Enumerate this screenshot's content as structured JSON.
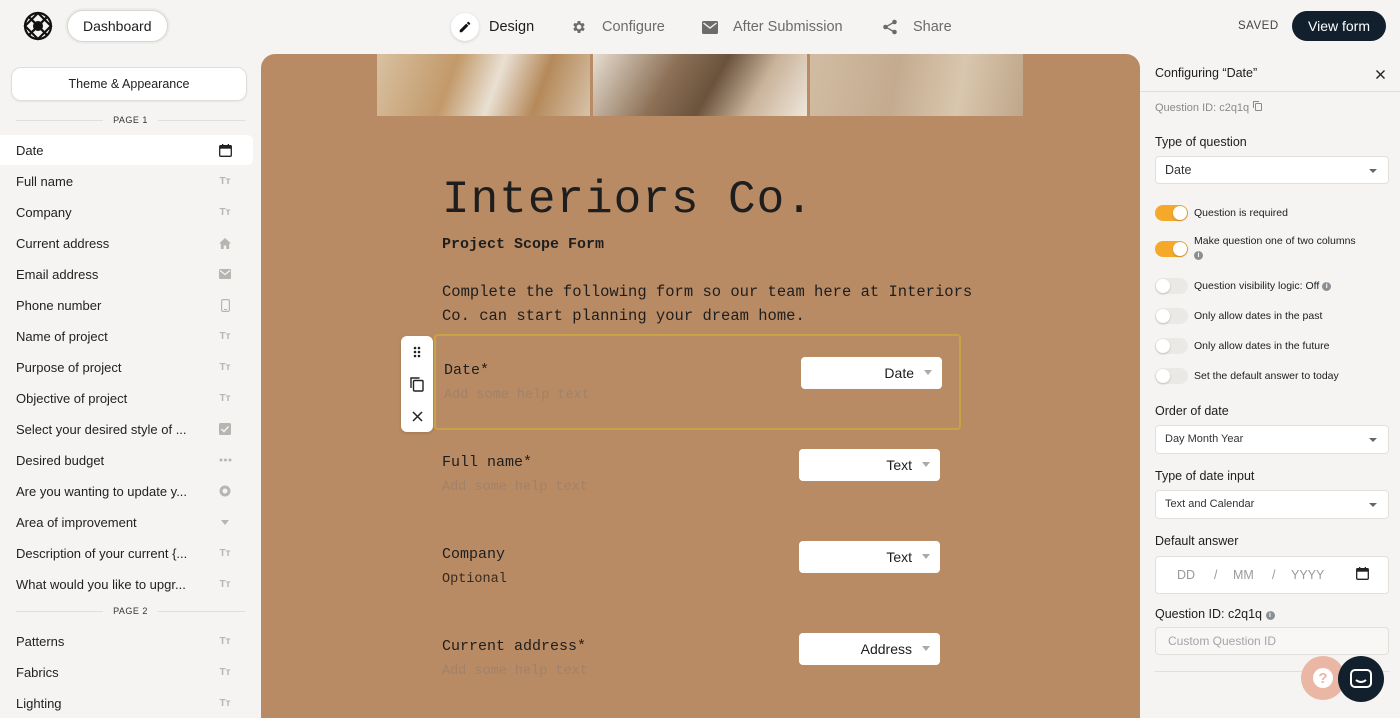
{
  "topbar": {
    "dashboard_label": "Dashboard",
    "tabs": [
      {
        "label": "Design",
        "icon": "pencil-icon"
      },
      {
        "label": "Configure",
        "icon": "gear-icon"
      },
      {
        "label": "After Submission",
        "icon": "envelope-icon"
      },
      {
        "label": "Share",
        "icon": "share-icon"
      }
    ],
    "status": "SAVED",
    "view_form_label": "View form"
  },
  "sidebar": {
    "theme_label": "Theme & Appearance",
    "page1_label": "PAGE 1",
    "page2_label": "PAGE 2",
    "page1_items": [
      {
        "label": "Date",
        "icon": "calendar-icon"
      },
      {
        "label": "Full name",
        "icon": "text-icon"
      },
      {
        "label": "Company",
        "icon": "text-icon"
      },
      {
        "label": "Current address",
        "icon": "home-icon"
      },
      {
        "label": "Email address",
        "icon": "email-icon"
      },
      {
        "label": "Phone number",
        "icon": "phone-icon"
      },
      {
        "label": "Name of project",
        "icon": "text-icon"
      },
      {
        "label": "Purpose of project",
        "icon": "text-icon"
      },
      {
        "label": "Objective of project",
        "icon": "text-icon"
      },
      {
        "label": "Select your desired style of ...",
        "icon": "checkbox-icon"
      },
      {
        "label": "Desired budget",
        "icon": "dots-icon"
      },
      {
        "label": "Are you wanting to update y...",
        "icon": "radio-icon"
      },
      {
        "label": "Area of improvement",
        "icon": "dropdown-icon"
      },
      {
        "label": "Description of your current {...",
        "icon": "text-icon"
      },
      {
        "label": "What would you like to upgr...",
        "icon": "text-icon"
      }
    ],
    "page2_items": [
      {
        "label": "Patterns",
        "icon": "text-icon"
      },
      {
        "label": "Fabrics",
        "icon": "text-icon"
      },
      {
        "label": "Lighting",
        "icon": "text-icon"
      }
    ],
    "text_icon_glyph": "Tт"
  },
  "form": {
    "title": "Interiors Co.",
    "subtitle": "Project Scope Form",
    "description": "Complete the following form so our team here at Interiors Co. can start planning your dream home.",
    "questions": [
      {
        "label": "Date*",
        "help": "Add some help text",
        "type": "Date"
      },
      {
        "label": "Full name*",
        "help": "Add some help text",
        "type": "Text"
      },
      {
        "label": "Company",
        "help": "Optional",
        "type": "Text"
      },
      {
        "label": "Current address*",
        "help": "Add some help text",
        "type": "Address"
      }
    ]
  },
  "config": {
    "title": "Configuring “Date”",
    "question_id_top": "Question ID: c2q1q",
    "type_label": "Type of question",
    "type_value": "Date",
    "toggles": [
      {
        "label": "Question is required",
        "on": true
      },
      {
        "label": "Make question one of two columns",
        "on": true
      },
      {
        "label": "Question visibility logic: Off",
        "on": false
      },
      {
        "label": "Only allow dates in the past",
        "on": false
      },
      {
        "label": "Only allow dates in the future",
        "on": false
      },
      {
        "label": "Set the default answer to today",
        "on": false
      }
    ],
    "order_label": "Order of date",
    "order_value": "Day Month Year",
    "input_type_label": "Type of date input",
    "input_type_value": "Text and Calendar",
    "default_label": "Default answer",
    "default_dd": "DD",
    "default_mm": "MM",
    "default_yyyy": "YYYY",
    "date_sep": "/",
    "qid_label": "Question ID: c2q1q",
    "custom_qid_placeholder": "Custom Question ID"
  },
  "colors": {
    "canvas": "#b98b64",
    "toggle_on": "#f4a92a",
    "primary_button": "#12202e",
    "selected_outline": "#c9a246"
  }
}
